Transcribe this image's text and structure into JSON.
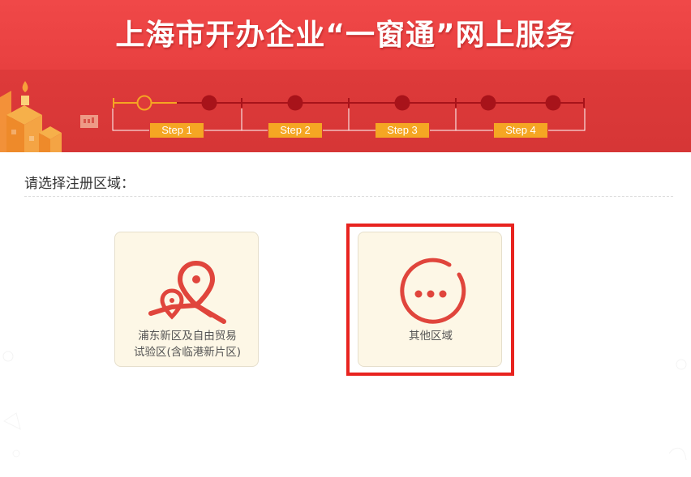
{
  "header": {
    "title": "上海市开办企业“一窗通”网上服务"
  },
  "steps": [
    {
      "label": "Step 1",
      "state": "current"
    },
    {
      "label": "Step 2",
      "state": "pending"
    },
    {
      "label": "Step 3",
      "state": "pending"
    },
    {
      "label": "Step 4",
      "state": "pending"
    }
  ],
  "main": {
    "prompt": "请选择注册区域：",
    "cards": [
      {
        "label_line1": "浦东新区及自由贸易",
        "label_line2": "试验区(含临港新片区)",
        "icon": "map-pin-route-icon",
        "selected": false
      },
      {
        "label_line1": "其他区域",
        "icon": "more-dots-icon",
        "selected": true
      }
    ]
  },
  "colors": {
    "banner_red": "#e84040",
    "step_dark_red": "#a8131a",
    "step_active": "#f5a623",
    "step_label_bg": "#f5a623",
    "icon_red": "#e0453c",
    "card_bg": "#fdf7e6",
    "selection_border": "#e8231f"
  }
}
